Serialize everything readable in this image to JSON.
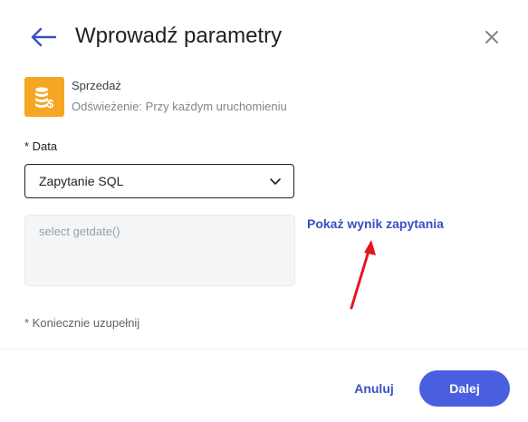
{
  "header": {
    "title": "Wprowadź parametry",
    "back_icon": "arrow-left-icon",
    "close_icon": "close-icon"
  },
  "source": {
    "name": "Sprzedaż",
    "refresh": "Odświeżenie: Przy każdym uruchomieniu",
    "icon": "database-coins-icon"
  },
  "field": {
    "label": "* Data",
    "select_value": "Zapytanie SQL",
    "query": "select getdate()",
    "show_result_link": "Pokaż wynik zapytania"
  },
  "required_note": "* Koniecznie uzupełnij",
  "footer": {
    "cancel_label": "Anuluj",
    "next_label": "Dalej"
  },
  "colors": {
    "accent": "#4a5fe0",
    "link": "#3a4fc4",
    "source_icon_bg": "#f5a623",
    "annotation": "#e8141c"
  }
}
